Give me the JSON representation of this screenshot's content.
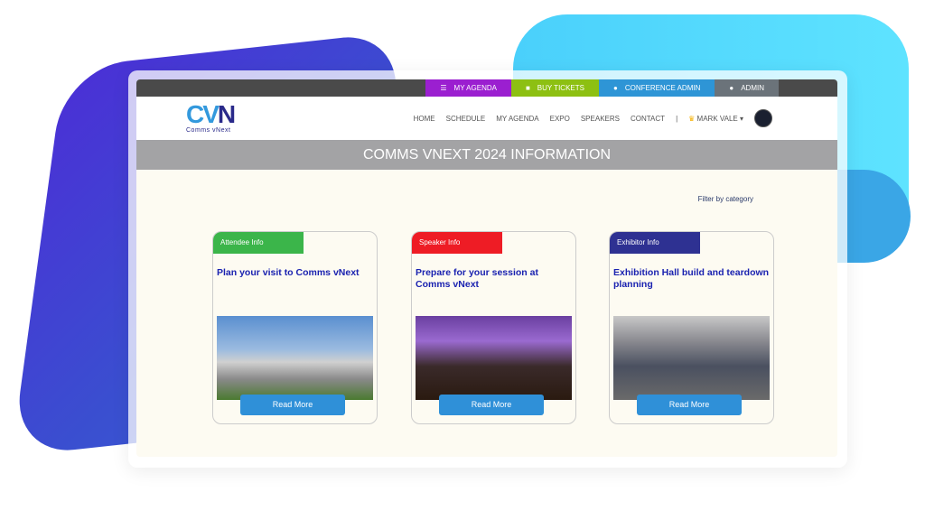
{
  "topbar": [
    {
      "label": "MY AGENDA",
      "icon": "list-icon",
      "color": "#9b1fd0"
    },
    {
      "label": "BUY TICKETS",
      "icon": "bag-icon",
      "color": "#8dc012"
    },
    {
      "label": "CONFERENCE ADMIN",
      "icon": "user-icon",
      "color": "#2e95d6"
    },
    {
      "label": "ADMIN",
      "icon": "user-icon",
      "color": "#6b737a"
    }
  ],
  "logo": {
    "mark": "CVN",
    "text": "Comms vNext"
  },
  "nav": {
    "items": [
      "HOME",
      "SCHEDULE",
      "MY AGENDA",
      "EXPO",
      "SPEAKERS",
      "CONTACT"
    ],
    "separator": "|",
    "user": "MARK VALE"
  },
  "banner": {
    "title": "COMMS VNEXT 2024 INFORMATION"
  },
  "filter": "Filter by category",
  "cards": [
    {
      "tag": "Attendee Info",
      "tag_color": "#3bb54a",
      "title": "Plan your visit to Comms vNext",
      "button": "Read More"
    },
    {
      "tag": "Speaker Info",
      "tag_color": "#ee1c25",
      "title": "Prepare for your session at Comms vNext",
      "button": "Read More"
    },
    {
      "tag": "Exhibitor Info",
      "tag_color": "#2e3192",
      "title": "Exhibition Hall build and teardown planning",
      "button": "Read More"
    }
  ]
}
